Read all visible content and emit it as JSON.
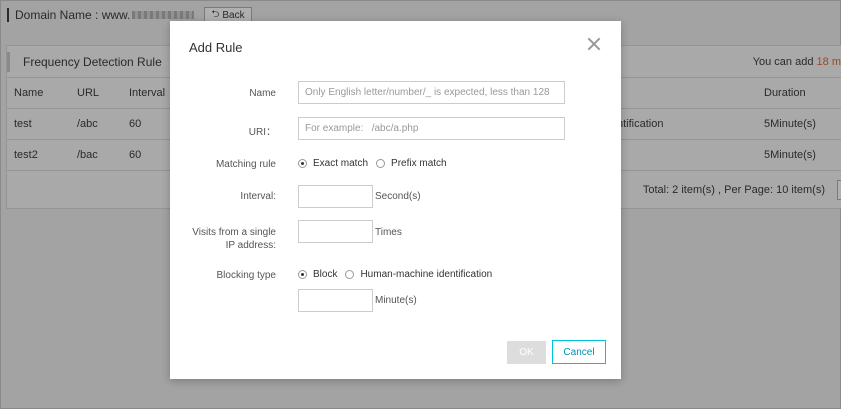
{
  "background": {
    "domain_label": "Domain Name : www.",
    "back_label": "Back",
    "panel_title": "Frequency Detection Rule",
    "quota_prefix": "You can add",
    "quota_num": "18",
    "quota_suffix": "m",
    "table": {
      "headers": [
        "Name",
        "URL",
        "Interval",
        "Duration"
      ],
      "rows": [
        {
          "name": "test",
          "url": "/abc",
          "interval": "60",
          "action": "ntification",
          "duration": "5Minute(s)"
        },
        {
          "name": "test2",
          "url": "/bac",
          "interval": "60",
          "action": "",
          "duration": "5Minute(s)"
        }
      ]
    },
    "footer_total": "Total: 2 item(s) ,  Per Page: 10 item(s)"
  },
  "modal": {
    "title": "Add Rule",
    "name_label": "Name",
    "name_placeholder": "Only English letter/number/_ is expected, less than 128",
    "uri_label": "URI：",
    "uri_placeholder": "For example:   /abc/a.php",
    "matching_label": "Matching rule",
    "matching_options": [
      "Exact match",
      "Prefix match"
    ],
    "matching_selected": "Exact match",
    "interval_label": "Interval:",
    "interval_unit": "Second(s)",
    "visits_label_line1": "Visits from a single",
    "visits_label_line2": "IP address:",
    "visits_unit": "Times",
    "blocking_label": "Blocking type",
    "blocking_options": [
      "Block",
      "Human-machine identification"
    ],
    "blocking_selected": "Block",
    "duration_unit": "Minute(s)",
    "ok_label": "OK",
    "cancel_label": "Cancel"
  },
  "colors": {
    "accent": "#00c1de",
    "ok_disabled": "#dddddd"
  }
}
